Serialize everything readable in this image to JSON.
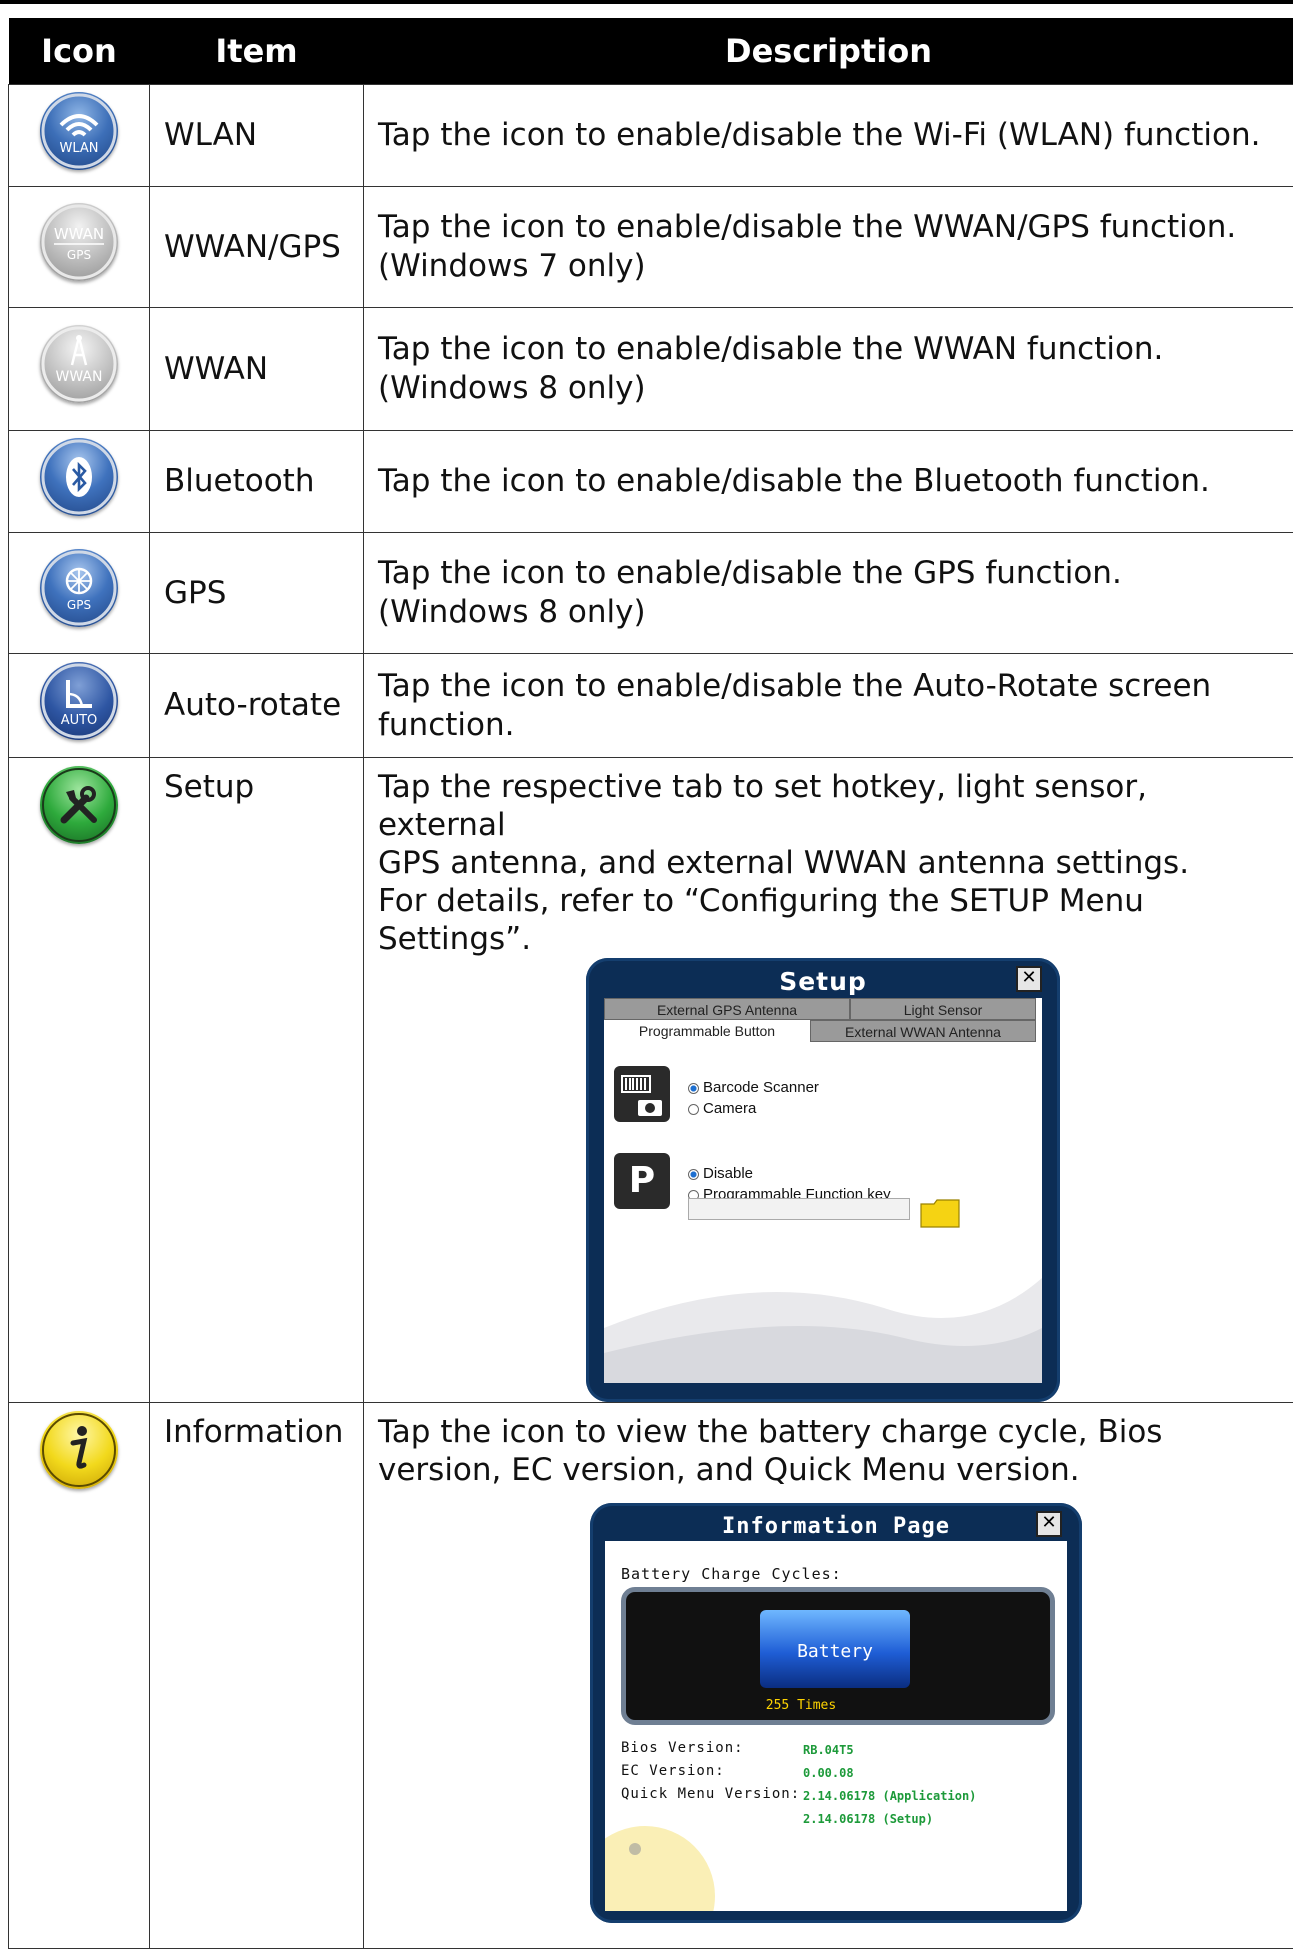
{
  "header": {
    "icon": "Icon",
    "item": "Item",
    "description": "Description"
  },
  "rows": [
    {
      "icon": "wlan-icon",
      "icon_text": "WLAN",
      "item": "WLAN",
      "desc": [
        "Tap the icon to enable/disable the Wi-Fi (WLAN) function."
      ]
    },
    {
      "icon": "wwan-gps-icon",
      "icon_text": "WWAN",
      "icon_text2": "GPS",
      "item": "WWAN/GPS",
      "desc": [
        "Tap the icon to enable/disable the WWAN/GPS function.",
        "(Windows 7 only)"
      ]
    },
    {
      "icon": "wwan-icon",
      "icon_text": "WWAN",
      "item": "WWAN",
      "desc": [
        "Tap the icon to enable/disable the WWAN function.",
        "(Windows 8 only)"
      ]
    },
    {
      "icon": "bluetooth-icon",
      "item": "Bluetooth",
      "desc": [
        "Tap the icon to enable/disable the Bluetooth function."
      ]
    },
    {
      "icon": "gps-icon",
      "icon_text": "GPS",
      "item": "GPS",
      "desc": [
        "Tap the icon to enable/disable the GPS function.",
        "(Windows 8 only)"
      ]
    },
    {
      "icon": "auto-rotate-icon",
      "icon_text": "AUTO",
      "item": "Auto-rotate",
      "desc": [
        "Tap the icon to enable/disable the Auto-Rotate screen",
        "function."
      ]
    },
    {
      "icon": "setup-icon",
      "item": "Setup",
      "desc": [
        "Tap the respective tab to set hotkey, light sensor, external",
        "GPS antenna, and external WWAN antenna settings.",
        "For details, refer to “Configuring the SETUP Menu",
        "Settings”."
      ]
    },
    {
      "icon": "information-icon",
      "item": "Information",
      "desc": [
        "Tap the icon to view the battery charge cycle, Bios",
        "version, EC version, and Quick Menu version."
      ]
    }
  ],
  "setup_window": {
    "title": "Setup",
    "tabs_top": [
      "External GPS Antenna",
      "Light Sensor"
    ],
    "tabs_bottom": [
      "Programmable Button",
      "External WWAN Antenna"
    ],
    "group1": [
      "Barcode Scanner",
      "Camera"
    ],
    "group2": [
      "Disable",
      "Programmable Function key"
    ],
    "key_label": "P"
  },
  "info_window": {
    "title": "Information Page",
    "battery_heading": "Battery Charge Cycles:",
    "battery_label": "Battery",
    "battery_times": "255 Times",
    "bios_label": "Bios Version:",
    "bios_value": "RB.04T5",
    "ec_label": "EC Version:",
    "ec_value": "0.00.08",
    "qm_label": "Quick Menu Version:",
    "qm_value_app": "2.14.06178 (Application)",
    "qm_value_setup": "2.14.06178 (Setup)"
  }
}
